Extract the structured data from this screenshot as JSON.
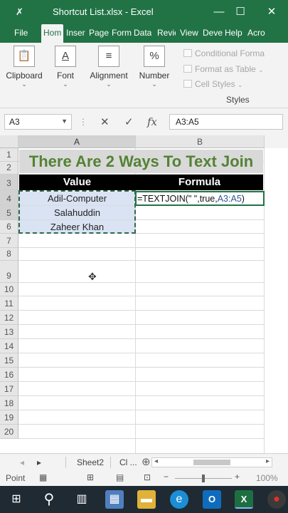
{
  "titlebar": {
    "save_icon": "save-icon",
    "title": "Shortcut List.xlsx  -  Excel",
    "minimize": "—",
    "restore": "☐",
    "close": "✕"
  },
  "tabs": [
    "File",
    "Hom",
    "Inser",
    "Page",
    "Form",
    "Data",
    "Revie",
    "View",
    "Deve",
    "Help",
    "Acro"
  ],
  "ribbon": {
    "clipboard": "Clipboard",
    "font": "Font",
    "alignment": "Alignment",
    "number": "Number",
    "conditional_formatting": "Conditional Forma",
    "format_as_table": "Format as Table",
    "cell_styles": "Cell Styles",
    "styles_group": "Styles",
    "caret": "⌄",
    "percent": "%"
  },
  "formula_bar": {
    "name_box": "A3",
    "cancel": "✕",
    "enter": "✓",
    "fx": "fx",
    "formula": "A3:A5"
  },
  "grid": {
    "columns": [
      "A",
      "B"
    ],
    "rows": [
      "1",
      "2",
      "3",
      "4",
      "5",
      "6",
      "7",
      "8",
      "9",
      "10",
      "11",
      "12",
      "13",
      "14",
      "15",
      "16",
      "17",
      "18",
      "19",
      "20"
    ],
    "title": "There Are 2 Ways To Text  Join",
    "header_value": "Value",
    "header_formula": "Formula",
    "values": [
      "Adil-Computer",
      "Salahuddin",
      "Zaheer Khan"
    ],
    "edit_formula_prefix": "=TEXTJOIN(\" \",true,",
    "edit_formula_ref": "A3:A5",
    "edit_formula_suffix": ")"
  },
  "sheetbar": {
    "prev": "◂",
    "next": "▸",
    "sheet2": "Sheet2",
    "sheet_cut": "Cl ...",
    "add": "⊕",
    "scroll_left": "◂",
    "scroll_right": "▸"
  },
  "status": {
    "mode": "Point",
    "zoom": "100%"
  }
}
